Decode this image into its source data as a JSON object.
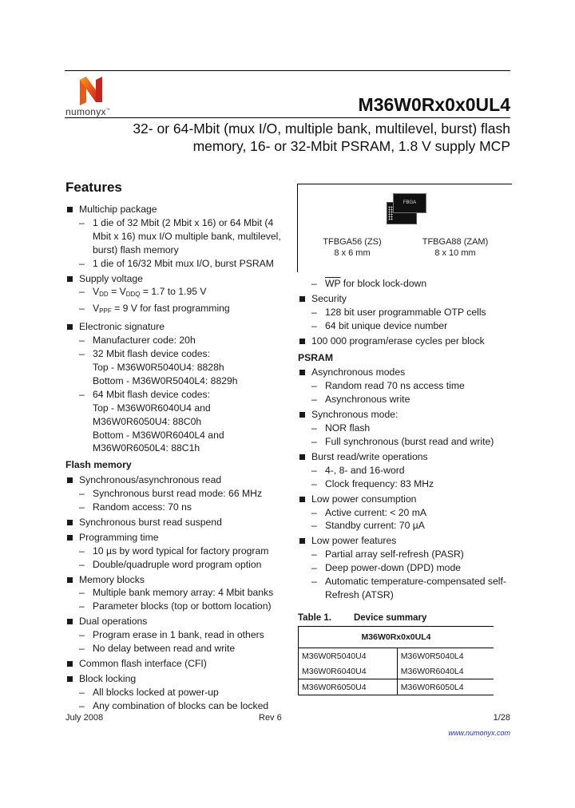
{
  "header": {
    "brand": "numonyx",
    "brand_mark": "™",
    "part_number": "M36W0Rx0x0UL4",
    "subtitle_line1": "32- or 64-Mbit (mux I/O, multiple bank, multilevel, burst) flash",
    "subtitle_line2": "memory, 16- or 32-Mbit PSRAM, 1.8 V supply MCP",
    "brand_color": "#e8501a"
  },
  "features_heading": "Features",
  "package": {
    "chip_label": "FBGA",
    "packages": [
      {
        "name": "TFBGA56 (ZS)",
        "size": "8 x 6 mm"
      },
      {
        "name": "TFBGA88 (ZAM)",
        "size": "8 x 10 mm"
      }
    ]
  },
  "left": {
    "multichip": {
      "label": "Multichip package",
      "subs": [
        "1 die of 32 Mbit (2 Mbit x 16) or 64 Mbit (4 Mbit x 16) mux I/O multiple bank, multilevel, burst) flash memory",
        "1 die of 16/32 Mbit mux I/O, burst PSRAM"
      ]
    },
    "supply": {
      "label": "Supply voltage",
      "vdd": {
        "v1": "V",
        "s1": "DD",
        "eq": " = V",
        "s2": "DDQ",
        "rest": " = 1.7 to 1.95 V"
      },
      "vpp": {
        "v": "V",
        "s": "PPF",
        "rest": " = 9 V for fast programming"
      }
    },
    "signature": {
      "label": "Electronic signature",
      "subs": [
        [
          "Manufacturer code: 20h"
        ],
        [
          "32 Mbit flash device codes:",
          "Top - M36W0R5040U4: 8828h",
          "Bottom - M36W0R5040L4: 8829h"
        ],
        [
          "64 Mbit flash device codes:",
          "Top - M36W0R6040U4 and",
          "M36W0R6050U4: 88C0h",
          "Bottom - M36W0R6040L4 and",
          "M36W0R6050L4: 88C1h"
        ]
      ]
    },
    "flash_heading": "Flash memory",
    "flash_items": [
      {
        "label": "Synchronous/asynchronous read",
        "subs": [
          "Synchronous burst read mode: 66 MHz",
          "Random access: 70 ns"
        ]
      },
      {
        "label": "Synchronous burst read suspend",
        "subs": []
      },
      {
        "label": "Programming time",
        "subs": [
          "10 µs by word typical for factory program",
          "Double/quadruple word program option"
        ]
      },
      {
        "label": "Memory blocks",
        "subs": [
          "Multiple bank memory array: 4 Mbit banks",
          "Parameter blocks (top or bottom location)"
        ]
      },
      {
        "label": "Dual operations",
        "subs": [
          "Program erase in 1 bank, read in others",
          "No delay between read and write"
        ]
      },
      {
        "label": "Common flash interface (CFI)",
        "subs": []
      },
      {
        "label": "Block locking",
        "subs": [
          "All blocks locked at power-up",
          "Any combination of blocks can be locked"
        ]
      }
    ]
  },
  "right": {
    "wp": {
      "signal": "WP",
      "rest": " for block lock-down"
    },
    "security": {
      "label": "Security",
      "subs": [
        "128 bit user programmable OTP cells",
        "64 bit unique device number"
      ]
    },
    "cycles": "100 000 program/erase cycles per block",
    "psram_heading": "PSRAM",
    "psram_items": [
      {
        "label": "Asynchronous modes",
        "subs": [
          "Random read 70 ns access time",
          "Asynchronous write"
        ]
      },
      {
        "label": "Synchronous mode:",
        "subs": [
          "NOR flash",
          "Full synchronous (burst read and write)"
        ]
      },
      {
        "label": "Burst read/write operations",
        "subs": [
          "4-, 8- and 16-word",
          "Clock frequency: 83 MHz"
        ]
      },
      {
        "label": "Low power consumption",
        "subs": [
          "Active current: < 20 mA",
          "Standby current: 70 µA"
        ]
      },
      {
        "label": "Low power features",
        "subs": [
          "Partial array self-refresh (PASR)",
          "Deep power-down (DPD) mode",
          "Automatic temperature-compensated self-Refresh (ATSR)"
        ]
      }
    ]
  },
  "table": {
    "caption_num": "Table 1.",
    "caption_title": "Device summary",
    "header": "M36W0Rx0x0UL4",
    "rows": [
      [
        "M36W0R5040U4",
        "M36W0R5040L4"
      ],
      [
        "M36W0R6040U4",
        "M36W0R6040L4"
      ],
      [
        "M36W0R6050U4",
        "M36W0R6050L4"
      ]
    ]
  },
  "footer": {
    "date": "July 2008",
    "revision": "Rev 6",
    "page": "1/28",
    "url": "www.numonyx.com"
  }
}
